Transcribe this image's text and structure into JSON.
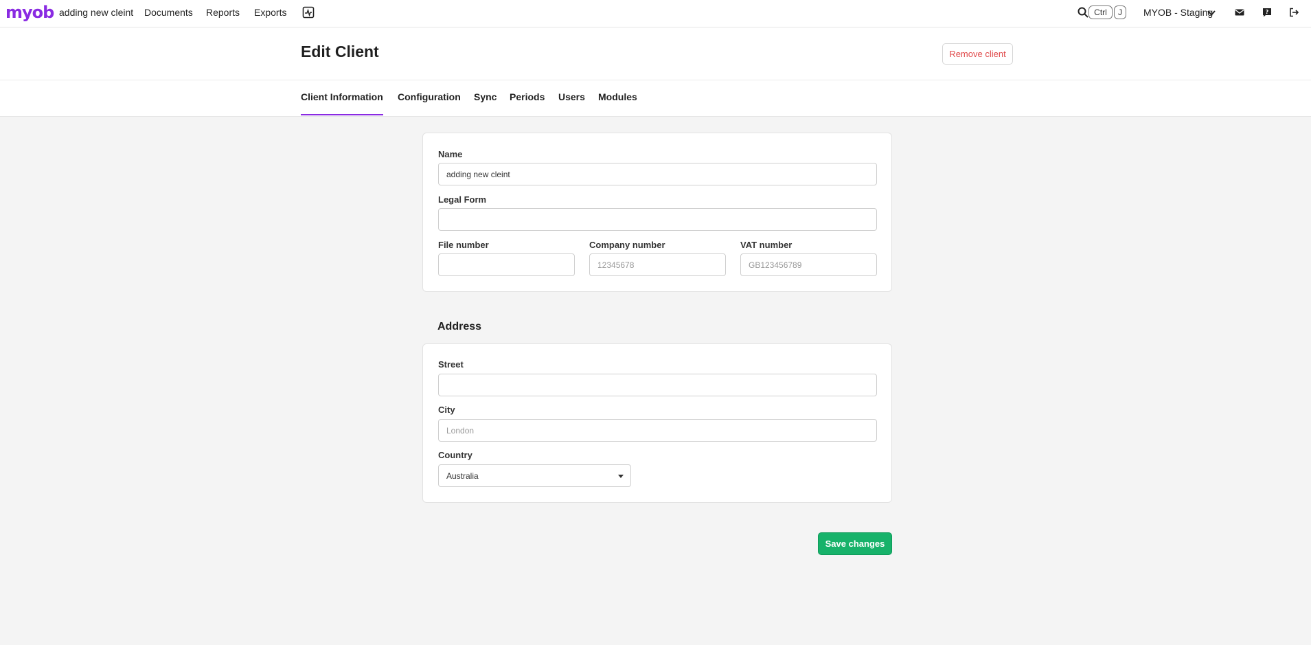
{
  "nav": {
    "logo": "myob",
    "client_name": "adding new cleint",
    "documents": "Documents",
    "reports": "Reports",
    "exports": "Exports",
    "kbd_ctrl": "Ctrl",
    "kbd_j": "J",
    "environment": "MYOB - Staging"
  },
  "header": {
    "title": "Edit Client",
    "remove_label": "Remove client"
  },
  "tabs": [
    {
      "label": "Client Information",
      "active": true
    },
    {
      "label": "Configuration"
    },
    {
      "label": "Sync"
    },
    {
      "label": "Periods"
    },
    {
      "label": "Users"
    },
    {
      "label": "Modules"
    }
  ],
  "info": {
    "name_label": "Name",
    "name_value": "adding new cleint",
    "legal_form_label": "Legal Form",
    "legal_form_value": "",
    "file_number_label": "File number",
    "file_number_value": "",
    "company_number_label": "Company number",
    "company_number_placeholder": "12345678",
    "vat_number_label": "VAT number",
    "vat_number_placeholder": "GB123456789"
  },
  "address": {
    "title": "Address",
    "street_label": "Street",
    "street_value": "",
    "city_label": "City",
    "city_placeholder": "London",
    "country_label": "Country",
    "country_value": "Australia"
  },
  "actions": {
    "save_label": "Save changes"
  },
  "colors": {
    "brand": "#8a2be2",
    "danger": "#e0494a",
    "success": "#17b26a"
  }
}
